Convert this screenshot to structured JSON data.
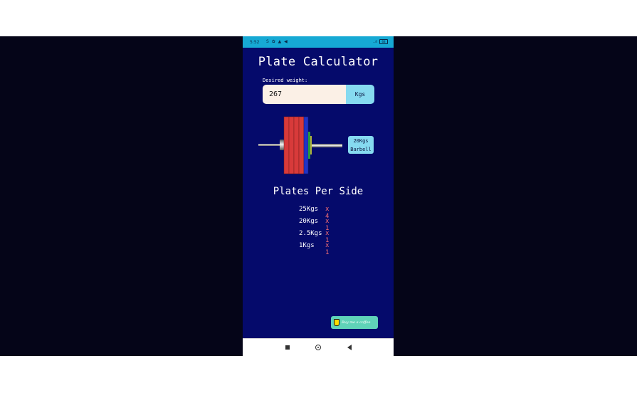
{
  "status_bar": {
    "time": "5:52",
    "left_icons": "S ✿ ▲ ◀",
    "signal": "..ıl",
    "battery": "68"
  },
  "app": {
    "title": "Plate Calculator",
    "input_label": "Desired weight:",
    "weight_value": "267",
    "unit_button": "Kgs"
  },
  "barbell": {
    "label_line1": "20Kgs",
    "label_line2": "Barbell"
  },
  "plates": {
    "title": "Plates Per Side",
    "rows": [
      {
        "weight": "25Kgs",
        "count": "x 4"
      },
      {
        "weight": "20Kgs",
        "count": "x 1"
      },
      {
        "weight": "2.5Kgs",
        "count": "x 1"
      },
      {
        "weight": "1Kgs",
        "count": "x 1"
      }
    ]
  },
  "coffee": {
    "label": "Buy me a coffee"
  },
  "colors": {
    "background": "#050a6b",
    "status_bar": "#16a9d4",
    "accent": "#86daf0",
    "plate_25": "#d83a3a",
    "plate_20": "#2233c4",
    "plate_2_5": "#2a9a3a",
    "plate_1": "#b0b040",
    "count_color": "#ef6b73"
  },
  "icons": {
    "coffee": "coffee-cup-icon",
    "nav_recent": "square-icon",
    "nav_home": "circle-icon",
    "nav_back": "triangle-back-icon"
  }
}
